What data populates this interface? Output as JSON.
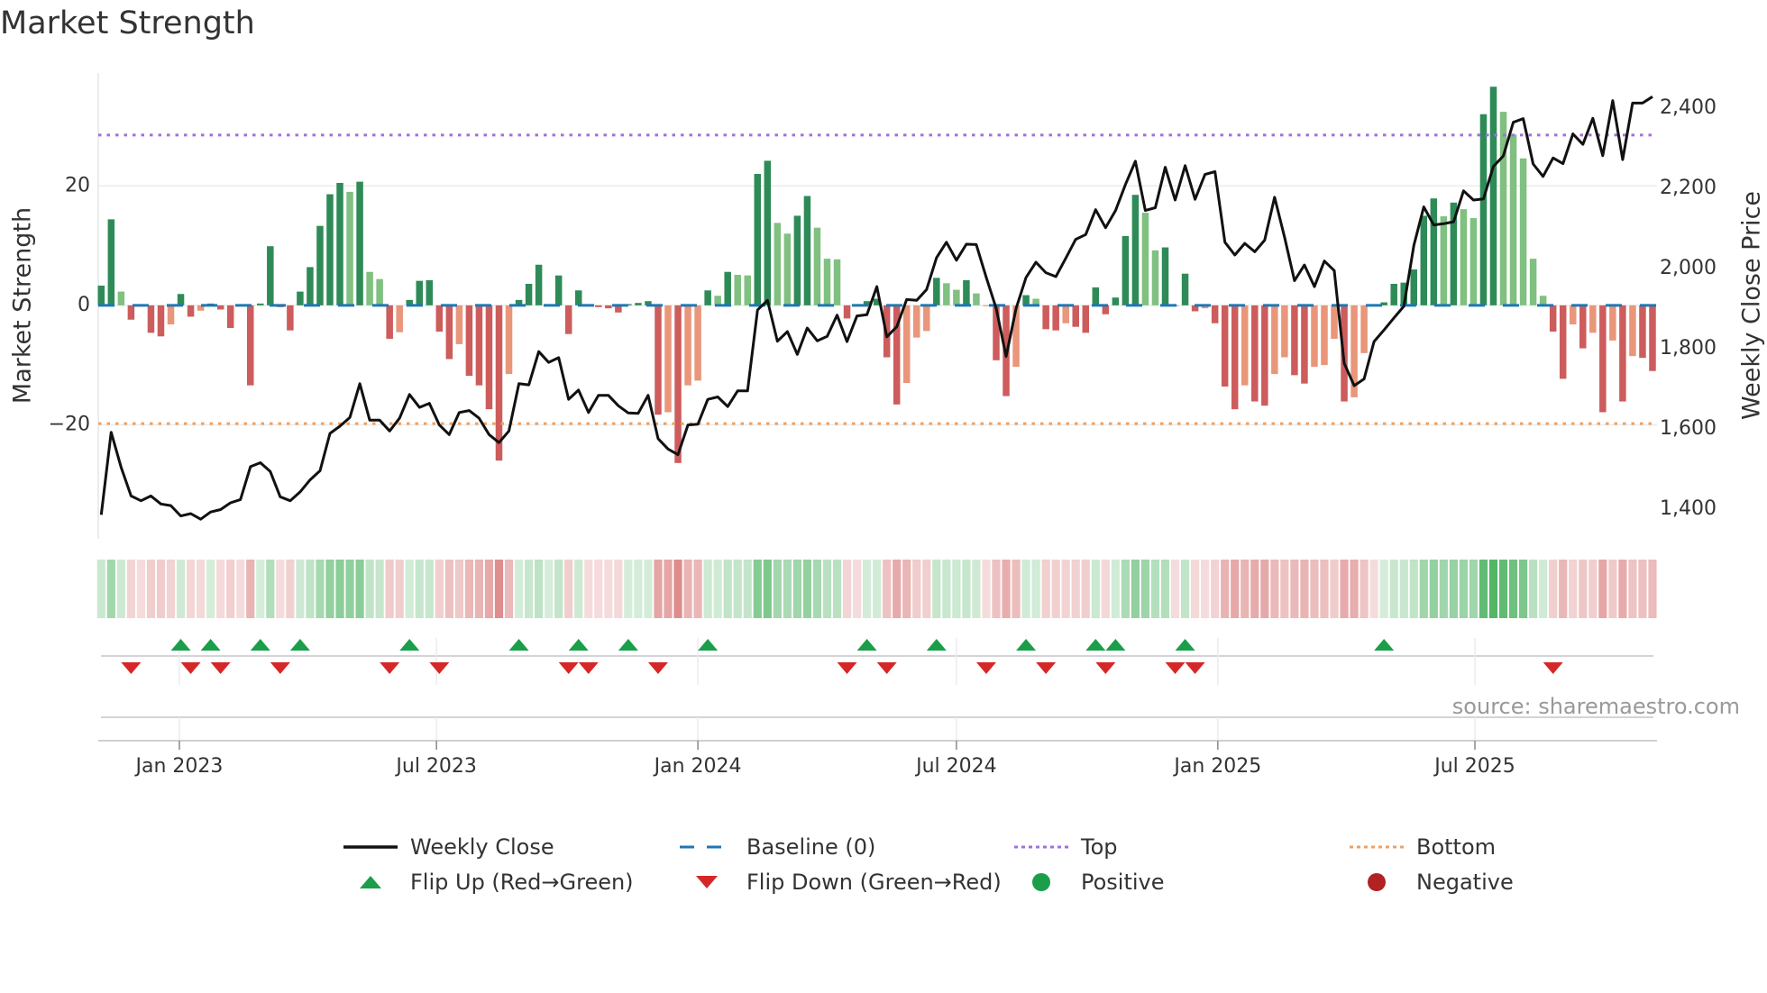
{
  "title": "Market Strength",
  "source": "source: sharemaestro.com",
  "legend": {
    "weekly_close": "Weekly Close",
    "baseline": "Baseline (0)",
    "top": "Top",
    "bottom": "Bottom",
    "flip_up": "Flip Up (Red→Green)",
    "flip_down": "Flip Down (Green→Red)",
    "positive": "Positive",
    "negative": "Negative"
  },
  "colors": {
    "bar_pos_strong": "#2e8b57",
    "bar_pos_weak": "#80c080",
    "bar_neg_strong": "#cd5c5c",
    "bar_neg_weak": "#e9967a",
    "baseline": "#1f77b4",
    "top": "#a070e0",
    "bottom": "#f0a060",
    "close": "#111111",
    "flip_up": "#1a9e4a",
    "flip_down": "#d62728",
    "positive": "#1a9e4a",
    "negative": "#b22222"
  },
  "chart_data": {
    "type": "bar",
    "title": "Market Strength",
    "ylabel": "Market Strength",
    "y2label": "Weekly Close Price",
    "ylim": [
      -39.1,
      38.9
    ],
    "y2lim": [
      1326,
      2488
    ],
    "yticks": [
      {
        "v": 20,
        "label": "20"
      },
      {
        "v": 0,
        "label": "0"
      },
      {
        "v": -20,
        "label": "−20"
      }
    ],
    "y2ticks": [
      {
        "v": 2400,
        "label": "2,400"
      },
      {
        "v": 2200,
        "label": "2,200"
      },
      {
        "v": 2000,
        "label": "2,000"
      },
      {
        "v": 1800,
        "label": "1,800"
      },
      {
        "v": 1600,
        "label": "1,600"
      },
      {
        "v": 1400,
        "label": "1,400"
      }
    ],
    "xticks": [
      {
        "date": "2023-01-01",
        "label": "Jan 2023"
      },
      {
        "date": "2023-07-01",
        "label": "Jul 2023"
      },
      {
        "date": "2024-01-01",
        "label": "Jan 2024"
      },
      {
        "date": "2024-07-01",
        "label": "Jul 2024"
      },
      {
        "date": "2025-01-01",
        "label": "Jan 2025"
      },
      {
        "date": "2025-07-01",
        "label": "Jul 2025"
      }
    ],
    "x_start": "2022-11-07",
    "x_step_days": 7,
    "top_level": 28.5,
    "bottom_level": -19.8,
    "baseline": 0,
    "grid": true,
    "legend_position": "bottom",
    "series": [
      {
        "name": "Market Strength",
        "type": "bar",
        "values": [
          3.3,
          14.4,
          2.3,
          -2.4,
          -0.2,
          -4.6,
          -5.2,
          -3.2,
          1.9,
          -1.9,
          -0.9,
          0.3,
          -0.7,
          -3.8,
          -0.1,
          -13.4,
          0.3,
          9.9,
          -0.3,
          -4.2,
          2.3,
          6.4,
          13.3,
          18.6,
          20.5,
          19,
          20.7,
          5.6,
          4.4,
          -5.6,
          -4.5,
          0.9,
          4.1,
          4.2,
          -4.4,
          -9,
          -6.5,
          -11.8,
          -13.4,
          -17.4,
          -26,
          -11.5,
          0.9,
          3.6,
          6.8,
          0.1,
          5.0,
          -4.8,
          2.5,
          -0.1,
          -0.3,
          -0.5,
          -1.2,
          0.2,
          0.4,
          0.7,
          -18.3,
          -17.9,
          -26.4,
          -13.4,
          -12.6,
          2.5,
          1.6,
          5.6,
          5.1,
          5.0,
          22,
          24.2,
          13.8,
          12,
          15,
          18.3,
          13,
          7.8,
          7.7,
          -2.2,
          -0.1,
          0.7,
          1.1,
          -8.7,
          -16.6,
          -13,
          -5.4,
          -4.3,
          4.6,
          3.7,
          2.6,
          4.2,
          2.0,
          -0.1,
          -9.2,
          -15.2,
          -10.3,
          1.7,
          1.1,
          -4.0,
          -4.2,
          -3.0,
          -3.6,
          -4.6,
          3.0,
          -1.5,
          1.3,
          11.6,
          18.5,
          15.5,
          9.2,
          9.7,
          -0.1,
          5.3,
          -1.0,
          -0.5,
          -3.0,
          -13.6,
          -17.4,
          -13.4,
          -16.1,
          -16.8,
          -11.5,
          -8.7,
          -11.7,
          -13.1,
          -10.3,
          -10,
          -5.6,
          -16.1,
          -15.4,
          -8.0,
          -0.1,
          0.5,
          3.6,
          3.8,
          6.0,
          15.0,
          17.9,
          14.9,
          17.2,
          16.1,
          14.6,
          32,
          36.6,
          32.4,
          28.6,
          24.6,
          7.8,
          1.6,
          -4.4,
          -12.3,
          -3.2,
          -7.2,
          -4.6,
          -17.9,
          -5.9,
          -16.1,
          -8.5,
          -8.8,
          -11.0
        ]
      },
      {
        "name": "Weekly Close",
        "type": "line",
        "axis": "right",
        "values": [
          1386,
          1592,
          1504,
          1433,
          1421,
          1433,
          1413,
          1409,
          1383,
          1389,
          1375,
          1393,
          1399,
          1416,
          1424,
          1506,
          1516,
          1494,
          1431,
          1421,
          1443,
          1473,
          1496,
          1589,
          1607,
          1629,
          1713,
          1622,
          1622,
          1595,
          1627,
          1686,
          1654,
          1664,
          1610,
          1586,
          1641,
          1646,
          1627,
          1586,
          1566,
          1595,
          1713,
          1710,
          1793,
          1766,
          1778,
          1674,
          1697,
          1641,
          1684,
          1684,
          1658,
          1640,
          1639,
          1684,
          1576,
          1550,
          1536,
          1610,
          1612,
          1674,
          1680,
          1656,
          1695,
          1695,
          1897,
          1921,
          1819,
          1843,
          1786,
          1852,
          1820,
          1831,
          1884,
          1818,
          1882,
          1885,
          1955,
          1830,
          1855,
          1923,
          1921,
          1948,
          2027,
          2066,
          2021,
          2061,
          2060,
          1978,
          1901,
          1781,
          1901,
          1978,
          2016,
          1990,
          1980,
          2026,
          2073,
          2085,
          2147,
          2102,
          2145,
          2210,
          2268,
          2145,
          2152,
          2253,
          2171,
          2257,
          2173,
          2235,
          2242,
          2066,
          2034,
          2063,
          2042,
          2071,
          2178,
          2078,
          1970,
          2009,
          1955,
          2019,
          1995,
          1764,
          1708,
          1725,
          1818,
          1847,
          1877,
          1906,
          2058,
          2154,
          2109,
          2112,
          2117,
          2194,
          2171,
          2174,
          2255,
          2281,
          2365,
          2374,
          2261,
          2230,
          2276,
          2262,
          2336,
          2310,
          2375,
          2282,
          2419,
          2272,
          2413,
          2413,
          2429
        ]
      }
    ]
  }
}
